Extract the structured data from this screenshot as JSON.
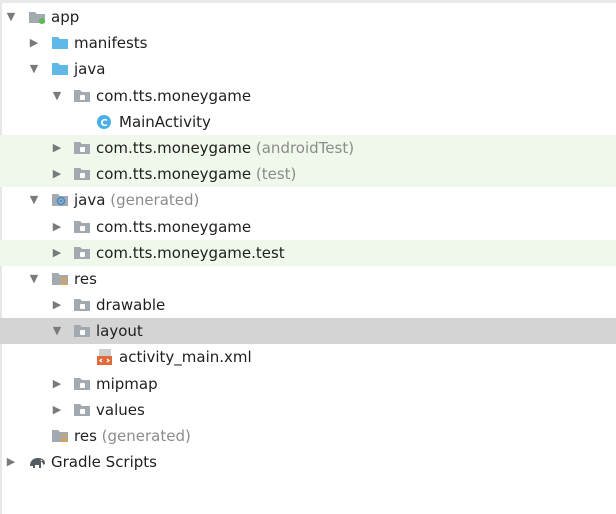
{
  "tree": {
    "app": "app",
    "manifests": "manifests",
    "java": "java",
    "pkg_main": "com.tts.moneygame",
    "main_activity": "MainActivity",
    "main_activity_badge": "C",
    "pkg_android_test": "com.tts.moneygame",
    "pkg_android_test_suffix": "(androidTest)",
    "pkg_test": "com.tts.moneygame",
    "pkg_test_suffix": "(test)",
    "java_generated": "java",
    "java_generated_suffix": "(generated)",
    "gen_pkg": "com.tts.moneygame",
    "gen_pkg_test": "com.tts.moneygame.test",
    "res": "res",
    "drawable": "drawable",
    "layout": "layout",
    "activity_main": "activity_main.xml",
    "mipmap": "mipmap",
    "values": "values",
    "res_generated": "res",
    "res_generated_suffix": "(generated)",
    "gradle_scripts": "Gradle Scripts"
  },
  "icons": {
    "folder_blue": "folder-icon",
    "folder_gray": "package-folder-icon",
    "class": "class-icon",
    "xml_layout": "xml-file-icon",
    "res_folder": "resource-folder-icon",
    "generated": "generated-source-icon",
    "gradle": "gradle-elephant-icon",
    "module": "module-folder-icon"
  },
  "colors": {
    "green_highlight": "#eff8ea",
    "selection": "#d4d4d4",
    "folder_blue": "#5fb8e6",
    "folder_gray": "#a3a9b0",
    "class_badge": "#4aaee6",
    "module_dot": "#5cb85c"
  }
}
